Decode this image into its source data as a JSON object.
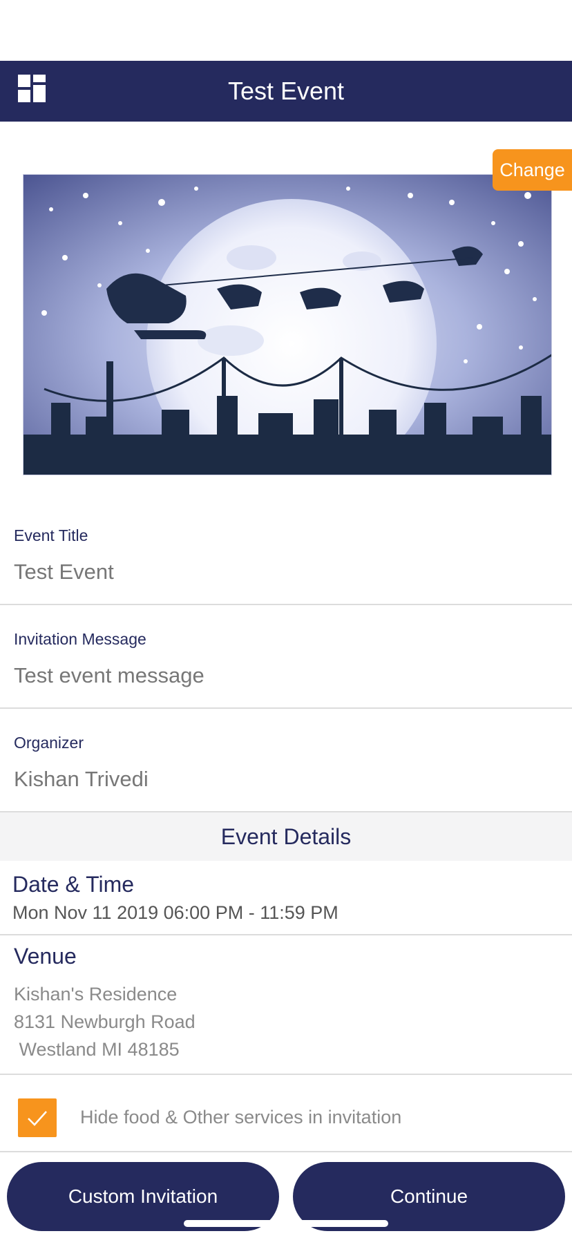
{
  "header": {
    "title": "Test Event",
    "menu_icon": "grid-menu-icon"
  },
  "banner": {
    "change_label": "Change"
  },
  "fields": [
    {
      "label": "Event Title",
      "value": "Test Event"
    },
    {
      "label": "Invitation Message",
      "value": "Test event message"
    },
    {
      "label": "Organizer",
      "value": "Kishan Trivedi"
    }
  ],
  "details": {
    "section_title": "Event Details",
    "datetime_label": "Date & Time",
    "datetime_value": "Mon Nov 11 2019 06:00 PM - 11:59 PM",
    "venue_label": "Venue",
    "venue_lines": [
      "Kishan's Residence",
      "8131 Newburgh Road",
      " Westland MI 48185"
    ]
  },
  "hide_services": {
    "label": "Hide food & Other services in invitation",
    "checked": true
  },
  "buttons": {
    "custom_invitation": "Custom Invitation",
    "continue": "Continue"
  },
  "colors": {
    "primary": "#252a5e",
    "accent": "#f7941d"
  }
}
